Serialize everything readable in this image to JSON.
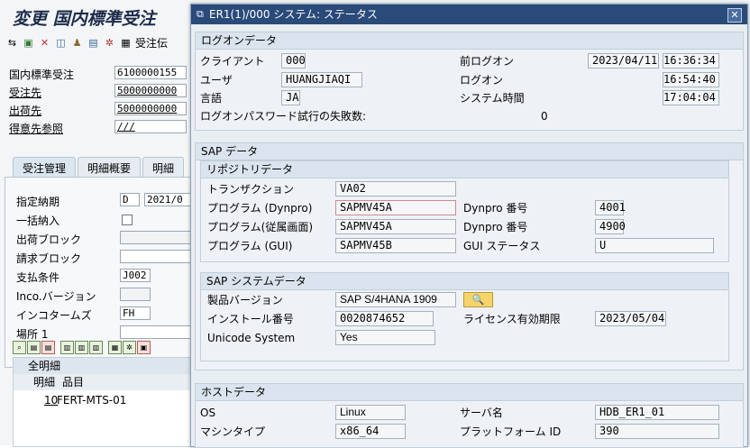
{
  "background_window": {
    "title": "変更 国内標準受注",
    "toolbar": {
      "items": [
        "back-forward-icon",
        "save-icon",
        "cancel-icon",
        "other-icon",
        "person-icon",
        "document-icon",
        "settings-icon"
      ],
      "label": "受注伝"
    },
    "header": [
      {
        "label": "国内標準受注",
        "value": "6100000155",
        "link": false
      },
      {
        "label": "受注先",
        "value": "5000000000",
        "link": true
      },
      {
        "label": "出荷先",
        "value": "5000000000",
        "link": true
      },
      {
        "label": "得意先参照",
        "value": "///",
        "link": true
      }
    ],
    "tabs": [
      "受注管理",
      "明細概要",
      "明細"
    ],
    "fields": [
      {
        "label": "指定納期",
        "value": "D",
        "value2": "2021/0"
      },
      {
        "label": "一括納入",
        "value": ""
      },
      {
        "label": "出荷ブロック",
        "value": ""
      },
      {
        "label": "請求ブロック",
        "value": ""
      },
      {
        "label": "支払条件",
        "value": "J002"
      },
      {
        "label": "Inco.バージョン",
        "value": ""
      },
      {
        "label": "インコタームズ",
        "value": "FH"
      },
      {
        "label": "場所 1",
        "value": ""
      }
    ],
    "items_table": {
      "title": "全明細",
      "columns": [
        "明細",
        "品目"
      ],
      "rows": [
        {
          "item": "10",
          "material": "FERT-MTS-01"
        }
      ]
    }
  },
  "dialog": {
    "title": "ER1(1)/000 システム: ステータス",
    "logon": {
      "heading": "ログオンデータ",
      "client_label": "クライアント",
      "client": "000",
      "user_label": "ユーザ",
      "user": "HUANGJIAQI",
      "lang_label": "言語",
      "lang": "JA",
      "failed_label": "ログオンパスワード試行の失敗数:",
      "failed": "0",
      "prev_logon_label": "前ログオン",
      "prev_logon_date": "2023/04/11",
      "prev_logon_time": "16:36:34",
      "logon_label": "ログオン",
      "logon_time": "16:54:40",
      "systime_label": "システム時間",
      "systime": "17:04:04"
    },
    "sap_data": {
      "heading": "SAP データ",
      "repo": {
        "heading": "リポジトリデータ",
        "transaction_label": "トランザクション",
        "transaction": "VA02",
        "program_dynpro_label": "プログラム (Dynpro)",
        "program_dynpro": "SAPMV45A",
        "dynpro_no_label": "Dynpro 番号",
        "dynpro_no": "4001",
        "program_sub_label": "プログラム(従属画面)",
        "program_sub": "SAPMV45A",
        "dynpro_no2_label": "Dynpro 番号",
        "dynpro_no2": "4900",
        "program_gui_label": "プログラム (GUI)",
        "program_gui": "SAPMV45B",
        "gui_status_label": "GUI ステータス",
        "gui_status": "U"
      },
      "system": {
        "heading": "SAP システムデータ",
        "version_label": "製品バージョン",
        "version": "SAP S/4HANA 1909",
        "install_label": "インストール番号",
        "install": "0020874652",
        "license_label": "ライセンス有効期限",
        "license": "2023/05/04",
        "unicode_label": "Unicode System",
        "unicode": "Yes"
      }
    },
    "host": {
      "heading": "ホストデータ",
      "os_label": "OS",
      "os": "Linux",
      "server_label": "サーバ名",
      "server": "HDB_ER1_01",
      "machine_label": "マシンタイプ",
      "machine": "x86_64",
      "platform_label": "プラットフォーム ID",
      "platform": "390"
    }
  }
}
